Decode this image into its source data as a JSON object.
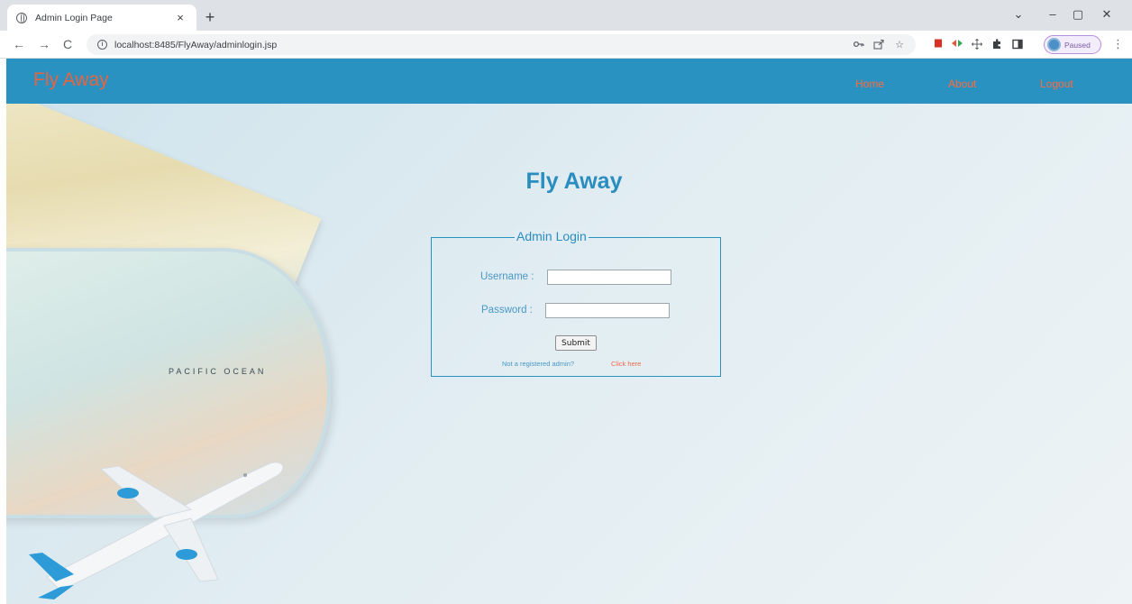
{
  "browser": {
    "tab_title": "Admin Login Page",
    "tab_close": "×",
    "new_tab": "+",
    "window": {
      "dropdown": "⌄",
      "minimize": "–",
      "maximize": "▢",
      "close": "✕"
    },
    "nav": {
      "back": "←",
      "forward": "→",
      "reload": "C"
    },
    "url": "localhost:8485/FlyAway/adminlogin.jsp",
    "profile_label": "Paused",
    "menu": "⋮",
    "icons": [
      "password-key-icon",
      "share-icon",
      "star-icon",
      "extension-red-icon",
      "extension-arrows-icon",
      "extension-move-icon",
      "puzzle-icon",
      "sidepanel-icon"
    ]
  },
  "navbar": {
    "brand": "Fly Away",
    "links": [
      "Home",
      "About",
      "Logout"
    ]
  },
  "page": {
    "title": "Fly Away",
    "map_label": "PACIFIC OCEAN",
    "login": {
      "legend": "Admin Login",
      "username_label": "Username :",
      "username_value": "",
      "password_label": "Password :",
      "password_value": "",
      "submit_label": "Submit",
      "register_text": "Not a registered admin?",
      "register_link": "Click here"
    }
  },
  "colors": {
    "navbar_bg": "#2a92c1",
    "brand": "#e8633f",
    "nav_link": "#ff6a3d",
    "heading": "#2a8dbf",
    "link": "#f06b4b"
  }
}
